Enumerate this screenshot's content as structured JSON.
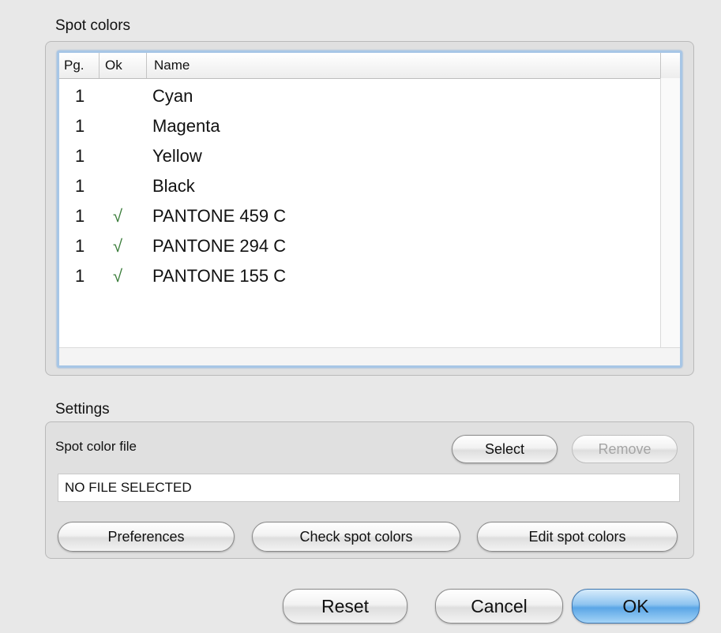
{
  "spot_colors": {
    "title": "Spot colors",
    "columns": {
      "pg": "Pg.",
      "ok": "Ok",
      "name": "Name"
    },
    "rows": [
      {
        "pg": "1",
        "ok": "",
        "name": "Cyan"
      },
      {
        "pg": "1",
        "ok": "",
        "name": "Magenta"
      },
      {
        "pg": "1",
        "ok": "",
        "name": "Yellow"
      },
      {
        "pg": "1",
        "ok": "",
        "name": "Black"
      },
      {
        "pg": "1",
        "ok": "√",
        "name": "PANTONE 459 C"
      },
      {
        "pg": "1",
        "ok": "√",
        "name": "PANTONE 294 C"
      },
      {
        "pg": "1",
        "ok": "√",
        "name": "PANTONE 155 C"
      }
    ]
  },
  "settings": {
    "title": "Settings",
    "spot_color_file_label": "Spot color file",
    "select_label": "Select",
    "remove_label": "Remove",
    "file_value": "NO FILE SELECTED",
    "preferences_label": "Preferences",
    "check_label": "Check spot colors",
    "edit_label": "Edit spot colors"
  },
  "footer": {
    "reset_label": "Reset",
    "cancel_label": "Cancel",
    "ok_label": "OK"
  },
  "colors": {
    "check_mark": "#3a7d3a",
    "focus_ring": "#a7c6e6",
    "default_button": "#5ba6e6"
  }
}
